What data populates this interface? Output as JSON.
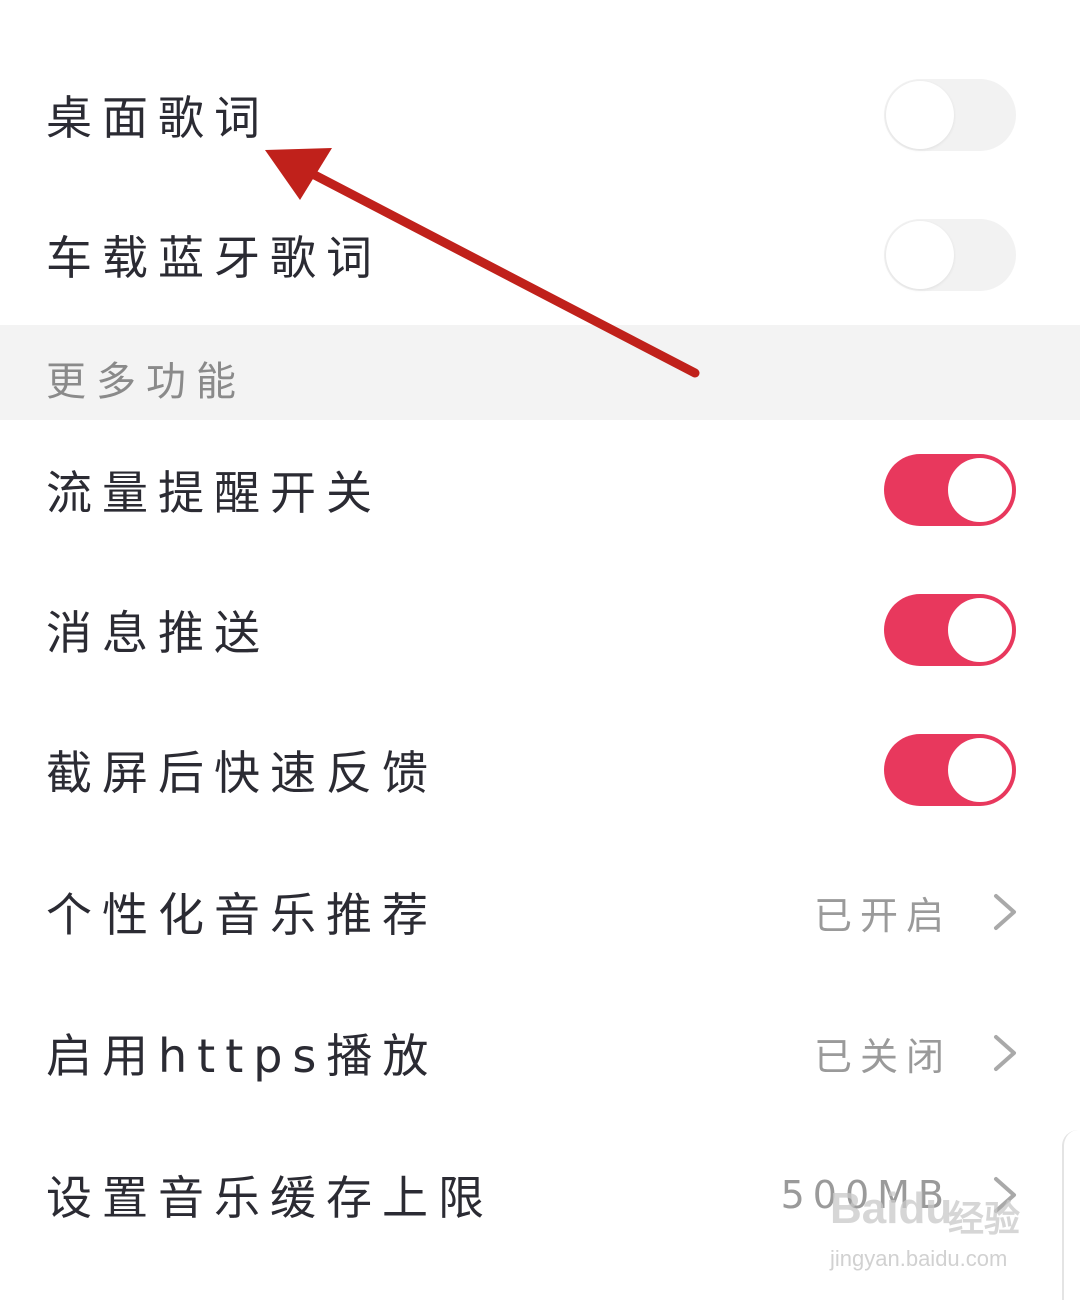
{
  "rows_top": [
    {
      "label": "桌面歌词",
      "toggle": "off"
    },
    {
      "label": "车载蓝牙歌词",
      "toggle": "off"
    }
  ],
  "section": {
    "title": "更多功能"
  },
  "rows_main": [
    {
      "label": "流量提醒开关",
      "toggle": "on"
    },
    {
      "label": "消息推送",
      "toggle": "on"
    },
    {
      "label": "截屏后快速反馈",
      "toggle": "on"
    },
    {
      "label": "个性化音乐推荐",
      "value": "已开启"
    },
    {
      "label": "启用https播放",
      "value": "已关闭"
    },
    {
      "label": "设置音乐缓存上限",
      "value": "500MB"
    }
  ],
  "colors": {
    "accent": "#e8385d",
    "annotation_arrow": "#c0211b"
  },
  "icons": {
    "chevron": "chevron-right-icon"
  },
  "watermark": {
    "brand": "Baidu",
    "cn": "经验",
    "url": "jingyan.baidu.com"
  }
}
